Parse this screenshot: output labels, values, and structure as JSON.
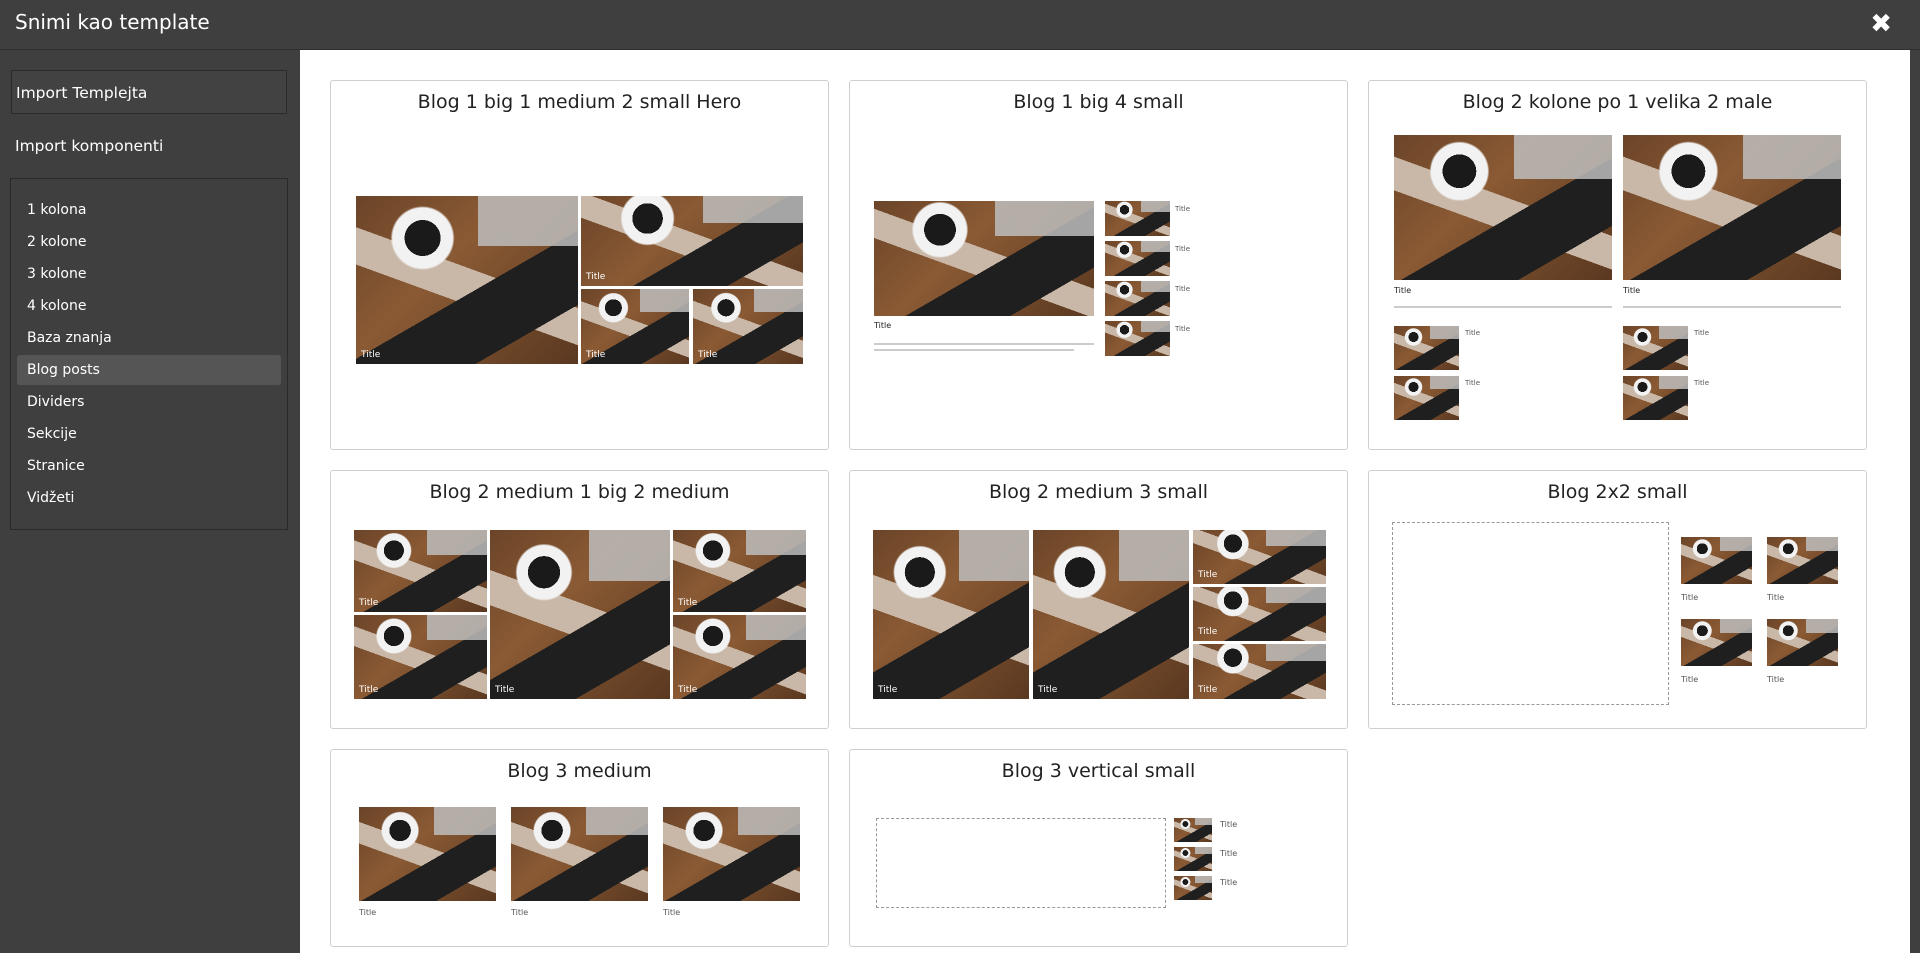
{
  "window": {
    "title": "Snimi kao template",
    "close_icon": "close-icon"
  },
  "sidebar": {
    "import_templates": "Import Templejta",
    "import_components": "Import komponenti",
    "items": [
      {
        "label": "1 kolona"
      },
      {
        "label": "2 kolone"
      },
      {
        "label": "3 kolone"
      },
      {
        "label": "4 kolone"
      },
      {
        "label": "Baza znanja"
      },
      {
        "label": "Blog posts",
        "active": true
      },
      {
        "label": "Dividers"
      },
      {
        "label": "Sekcije"
      },
      {
        "label": "Stranice"
      },
      {
        "label": "Vidžeti"
      }
    ]
  },
  "cards": [
    {
      "title": "Blog 1 big 1 medium 2 small Hero",
      "thumb_label": "Title"
    },
    {
      "title": "Blog 1 big 4 small",
      "thumb_label": "Title"
    },
    {
      "title": "Blog 2 kolone po 1 velika 2 male",
      "thumb_label": "Title"
    },
    {
      "title": "Blog 2 medium 1 big 2 medium",
      "thumb_label": "Title"
    },
    {
      "title": "Blog 2 medium 3 small",
      "thumb_label": "Title"
    },
    {
      "title": "Blog 2x2 small",
      "thumb_label": "Title"
    },
    {
      "title": "Blog 3 medium",
      "thumb_label": "Title"
    },
    {
      "title": "Blog 3 vertical small",
      "thumb_label": "Title"
    }
  ]
}
